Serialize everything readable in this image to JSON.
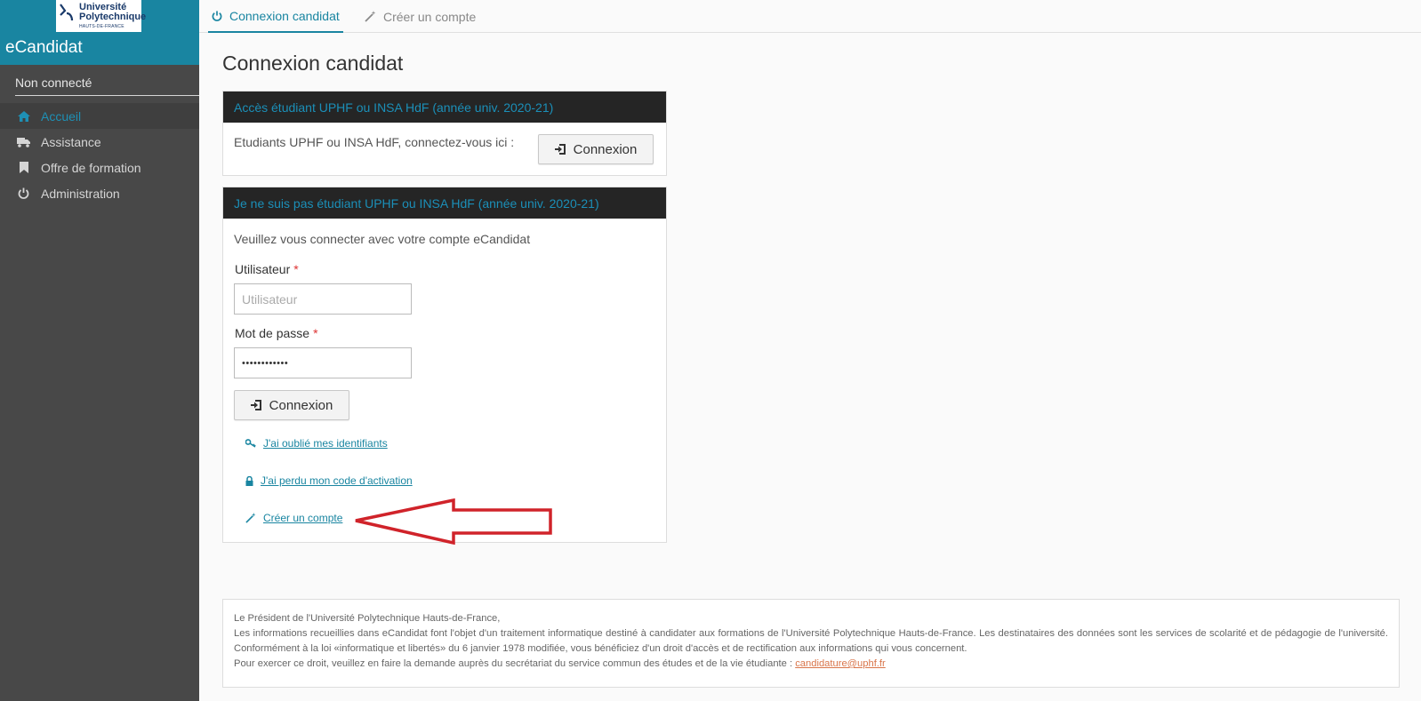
{
  "sidebar": {
    "logo": {
      "line1": "Université",
      "line2": "Polytechnique",
      "line3": "HAUTS-DE-FRANCE"
    },
    "app_title": "eCandidat",
    "user_status": "Non connecté",
    "items": [
      {
        "label": "Accueil",
        "icon": "home-icon",
        "active": true
      },
      {
        "label": "Assistance",
        "icon": "truck-icon",
        "active": false
      },
      {
        "label": "Offre de formation",
        "icon": "bookmark-icon",
        "active": false
      },
      {
        "label": "Administration",
        "icon": "power-icon",
        "active": false
      }
    ]
  },
  "tabs": [
    {
      "label": "Connexion candidat",
      "icon": "power-icon",
      "active": true
    },
    {
      "label": "Créer un compte",
      "icon": "magic-wand-icon",
      "active": false
    }
  ],
  "page_title": "Connexion candidat",
  "panel_student": {
    "title": "Accès étudiant UPHF ou INSA HdF (année univ. 2020-21)",
    "text": "Etudiants UPHF ou INSA HdF, connectez-vous ici :",
    "button_label": "Connexion"
  },
  "panel_account": {
    "title": "Je ne suis pas étudiant UPHF ou INSA HdF (année univ. 2020-21)",
    "intro": "Veuillez vous connecter avec votre compte eCandidat",
    "username_label": "Utilisateur",
    "username_placeholder": "Utilisateur",
    "username_value": "",
    "password_label": "Mot de passe",
    "password_value": "••••••••••••",
    "required_mark": "*",
    "button_label": "Connexion",
    "links": {
      "forgot_ids": "J'ai oublié mes identifiants",
      "lost_code": "J'ai perdu mon code d'activation",
      "create_account": "Créer un compte"
    }
  },
  "footer": {
    "line1": "Le Président de l'Université Polytechnique Hauts-de-France,",
    "line2": "Les informations recueillies dans eCandidat font l'objet d'un traitement informatique destiné à candidater aux formations de l'Université Polytechnique Hauts-de-France. Les destinataires des données sont les services de scolarité et de pédagogie de l'université. Conformément à la loi «informatique et libertés» du 6 janvier 1978 modifiée, vous bénéficiez d'un droit d'accès et de rectification aux informations qui vous concernent.",
    "line3": "Pour exercer ce droit, veuillez en faire la demande auprès du secrétariat du service commun des études et de la vie étudiante :",
    "email": "candidature@uphf.fr"
  },
  "colors": {
    "accent": "#1985a1",
    "sidebar_bg": "#484848",
    "panel_header_bg": "#252525",
    "arrow": "#d0232a",
    "required": "#dd3333",
    "email_link": "#d9754a"
  }
}
